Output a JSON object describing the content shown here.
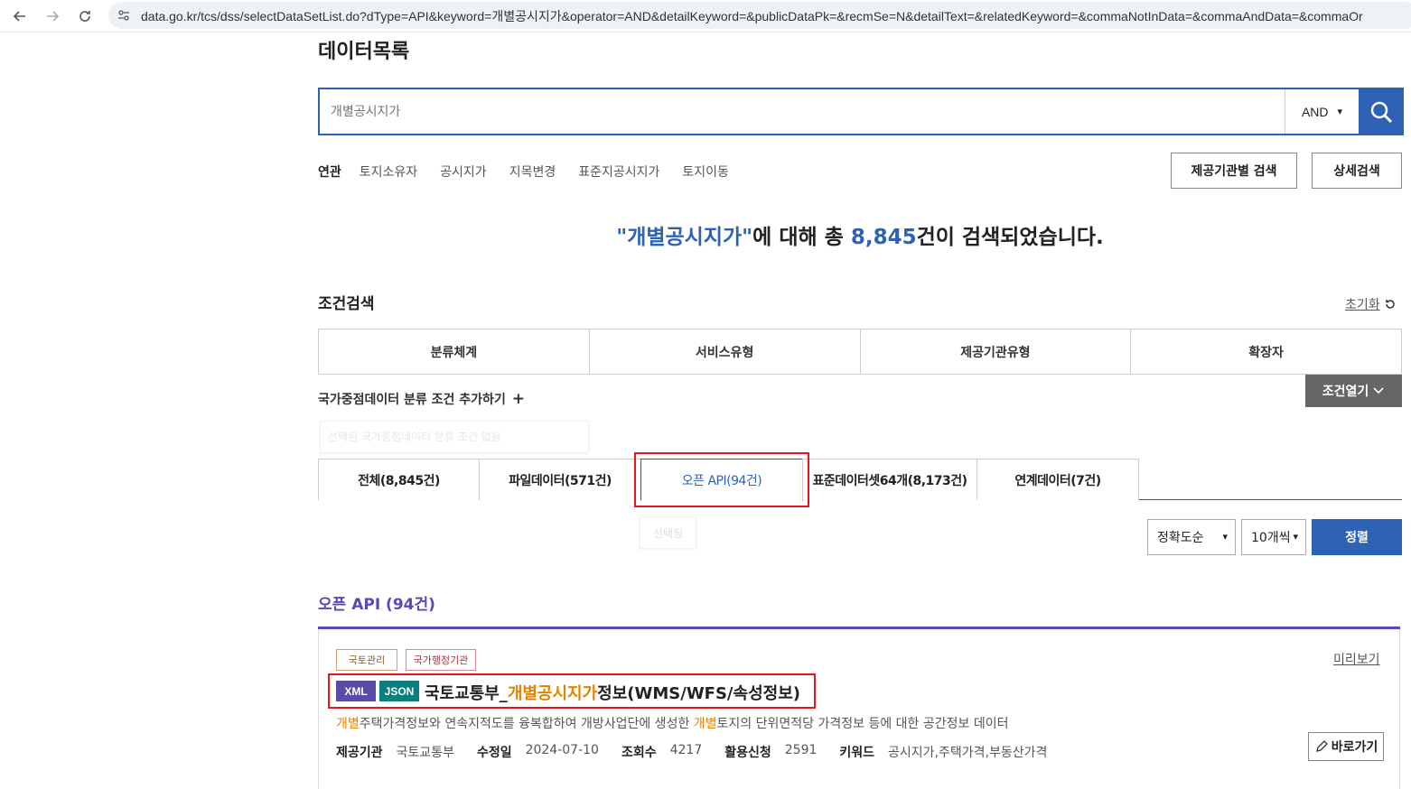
{
  "browser": {
    "url": "data.go.kr/tcs/dss/selectDataSetList.do?dType=API&keyword=개별공시지가&operator=AND&detailKeyword=&publicDataPk=&recmSe=N&detailText=&relatedKeyword=&commaNotInData=&commaAndData=&commaOr"
  },
  "page": {
    "title": "데이터목록"
  },
  "search": {
    "placeholder": "개별공시지가",
    "operator": "AND"
  },
  "related": {
    "label": "연관",
    "items": [
      "토지소유자",
      "공시지가",
      "지목변경",
      "표준지공시지가",
      "토지이동"
    ]
  },
  "buttons": {
    "org_search": "제공기관별 검색",
    "detail_search": "상세검색",
    "open_conditions": "조건열기",
    "sort": "정렬",
    "goto": "바로가기"
  },
  "result": {
    "keyword": "\"개별공시지가\"",
    "middle": "에 대해 총 ",
    "count": "8,845",
    "suffix": "건이 검색되었습니다."
  },
  "conditions": {
    "title": "조건검색",
    "reset": "초기화",
    "tabs": [
      "분류체계",
      "서비스유형",
      "제공기관유형",
      "확장자"
    ],
    "add_label": "국가중점데이터 분류 조건 추가하기",
    "ghost_text": "선택된 국가중점데이터 분류 조건 없음"
  },
  "type_tabs": [
    {
      "label": "전체(8,845건)"
    },
    {
      "label": "파일데이터(571건)"
    },
    {
      "label": "오픈 API(94건)"
    },
    {
      "label": "표준데이터셋64개(8,173건)"
    },
    {
      "label": "연계데이터(7건)"
    }
  ],
  "tooltip": "선택됨",
  "sort_options": {
    "order": "정확도순",
    "per_page": "10개씩"
  },
  "list": {
    "title": "오픈 API (94건)",
    "items": [
      {
        "tags": [
          "국토관리",
          "국가행정기관"
        ],
        "preview": "미리보기",
        "formats": [
          "XML",
          "JSON"
        ],
        "title_pre": "국토교통부_",
        "title_kw": "개별공시지가",
        "title_post": "정보(WMS/WFS/속성정보)",
        "desc_kw1": "개별",
        "desc_mid": "주택가격정보와 연속지적도를 융복합하여 개방사업단에 생성한 ",
        "desc_kw2": "개별",
        "desc_end": "토지의 단위면적당 가격정보 등에 대한 공간정보 데이터",
        "meta": {
          "org_label": "제공기관",
          "org": "국토교통부",
          "mod_label": "수정일",
          "mod": "2024-07-10",
          "views_label": "조회수",
          "views": "4217",
          "apply_label": "활용신청",
          "apply": "2591",
          "kw_label": "키워드",
          "kw": "공시지가,주택가격,부동산가격"
        }
      }
    ]
  },
  "colors": {
    "primary": "#2d62b4",
    "purple": "#5a48b8",
    "highlight": "#e08300",
    "annotation": "#e3161c"
  }
}
